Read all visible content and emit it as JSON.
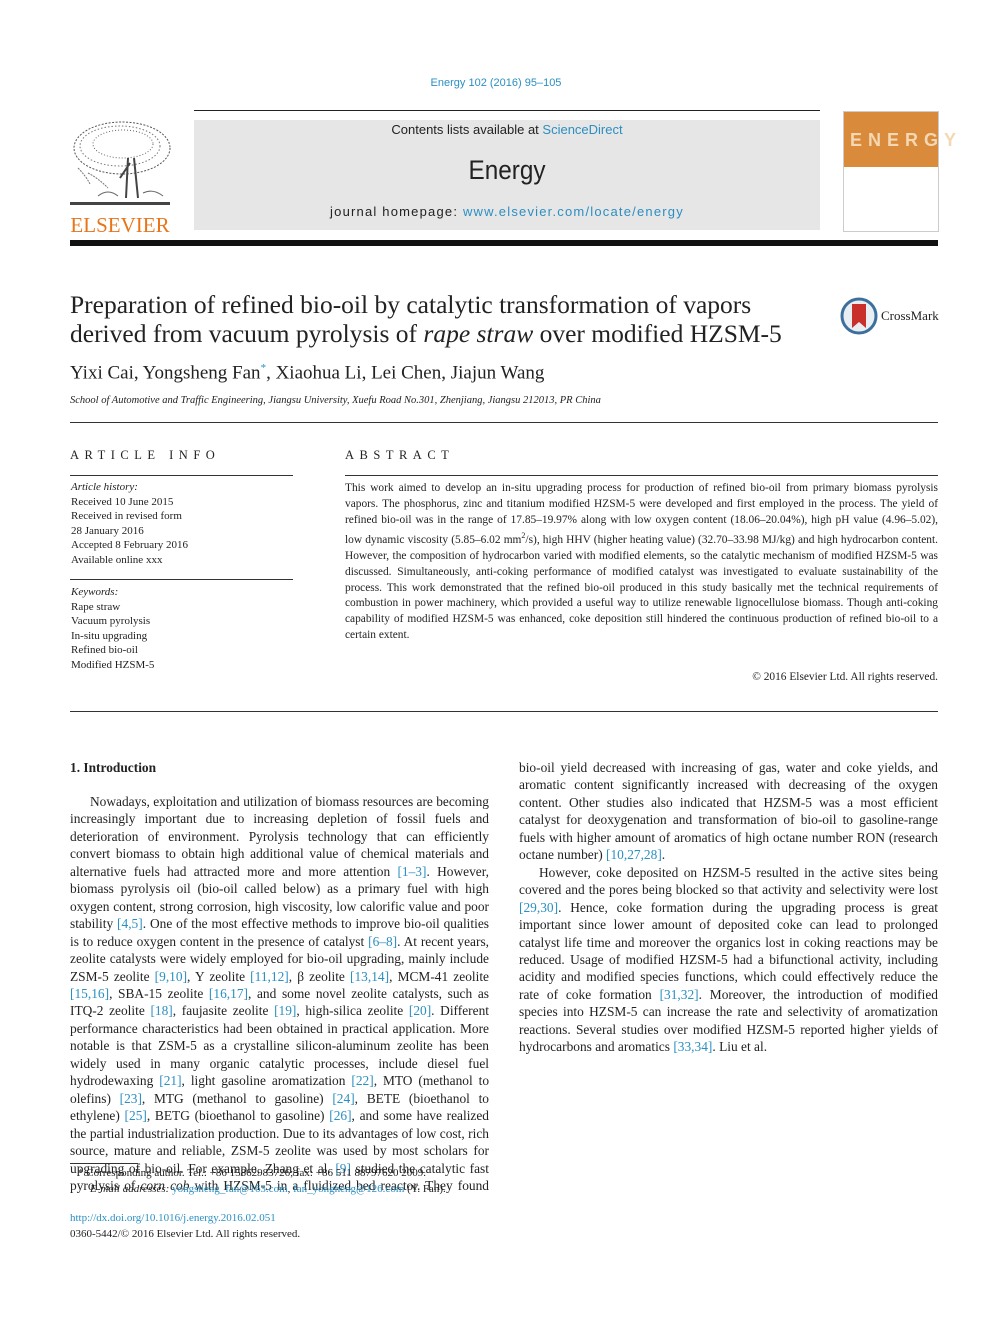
{
  "header": {
    "journal_ref": "Energy 102 (2016) 95–105",
    "contents_prefix": "Contents lists available at ",
    "contents_link": "ScienceDirect",
    "journal_name": "Energy",
    "homepage_prefix": "journal homepage: ",
    "homepage_link": "www.elsevier.com/locate/energy",
    "publisher_logo_text": "ELSEVIER",
    "cover_word": "ENERGY",
    "brand_color": "#e8751a",
    "link_color": "#2b8fc2",
    "cover_color": "#d98a3a"
  },
  "article": {
    "title_part1": "Preparation of refined bio-oil by catalytic transformation of vapors derived from vacuum pyrolysis of ",
    "title_italic": "rape straw",
    "title_part2": " over modified HZSM-5",
    "crossmark_label": "CrossMark",
    "authors_part1": "Yixi Cai, Yongsheng Fan",
    "authors_mark": "*",
    "authors_part2": ", Xiaohua Li, Lei Chen, Jiajun Wang",
    "affiliation": "School of Automotive and Traffic Engineering, Jiangsu University, Xuefu Road No.301, Zhenjiang, Jiangsu 212013, PR China"
  },
  "article_info": {
    "label": "ARTICLE INFO",
    "history_label": "Article history:",
    "history": [
      "Received 10 June 2015",
      "Received in revised form",
      "28 January 2016",
      "Accepted 8 February 2016",
      "Available online xxx"
    ],
    "keywords_label": "Keywords:",
    "keywords": [
      "Rape straw",
      "Vacuum pyrolysis",
      "In-situ upgrading",
      "Refined bio-oil",
      "Modified HZSM-5"
    ]
  },
  "abstract": {
    "label": "ABSTRACT",
    "text_part1": "This work aimed to develop an in-situ upgrading process for production of refined bio-oil from primary biomass pyrolysis vapors. The phosphorus, zinc and titanium modified HZSM-5 were developed and first employed in the process. The yield of refined bio-oil was in the range of 17.85–19.97% along with low oxygen content (18.06–20.04%), high pH value (4.96–5.02), low dynamic viscosity (5.85–6.02 mm",
    "text_sup": "2",
    "text_part2": "/s), high HHV (higher heating value) (32.70–33.98 MJ/kg) and high hydrocarbon content. However, the composition of hydrocarbon varied with modified elements, so the catalytic mechanism of modified HZSM-5 was discussed. Simultaneously, anti-coking performance of modified catalyst was investigated to evaluate sustainability of the process. This work demonstrated that the refined bio-oil produced in this study basically met the technical requirements of combustion in power machinery, which provided a useful way to utilize renewable lignocellulose biomass. Though anti-coking capability of modified HZSM-5 was enhanced, coke deposition still hindered the continuous production of refined bio-oil to a certain extent.",
    "copyright": "© 2016 Elsevier Ltd. All rights reserved."
  },
  "body": {
    "intro_heading": "1.  Introduction",
    "p1": [
      {
        "t": "Nowadays, exploitation and utilization of biomass resources are becoming increasingly important due to increasing depletion of fossil fuels and deterioration of environment. Pyrolysis technology that can efficiently convert biomass to obtain high additional value of chemical materials and alternative fuels had attracted more and more attention "
      },
      {
        "r": "[1–3]"
      },
      {
        "t": ". However, biomass pyrolysis oil (bio-oil called below) as a primary fuel with high oxygen content, strong corrosion, high viscosity, low calorific value and poor stability "
      },
      {
        "r": "[4,5]"
      },
      {
        "t": ". One of the most effective methods to improve bio-oil qualities is to reduce oxygen content in the presence of catalyst "
      },
      {
        "r": "[6–8]"
      },
      {
        "t": ". At recent years, zeolite catalysts were widely employed for bio-oil upgrading, mainly include ZSM-5 zeolite "
      },
      {
        "r": "[9,10]"
      },
      {
        "t": ", Y zeolite "
      },
      {
        "r": "[11,12]"
      },
      {
        "t": ", β zeolite "
      },
      {
        "r": "[13,14]"
      },
      {
        "t": ", MCM-41 zeolite "
      },
      {
        "r": "[15,16]"
      },
      {
        "t": ", SBA-15 zeolite "
      },
      {
        "r": "[16,17]"
      },
      {
        "t": ", and some novel zeolite catalysts, such as ITQ-2 zeolite "
      },
      {
        "r": "[18]"
      },
      {
        "t": ", faujasite zeolite "
      },
      {
        "r": "[19]"
      },
      {
        "t": ", high-silica zeolite "
      },
      {
        "r": "[20]"
      },
      {
        "t": ". Different performance characteristics had been obtained in practical application. More notable is that ZSM-5 as a crystalline silicon-aluminum zeolite has been widely used in many organic catalytic processes, include diesel fuel hydrodewaxing "
      },
      {
        "r": "[21]"
      },
      {
        "t": ", light gasoline aromatization "
      },
      {
        "r": "[22]"
      },
      {
        "t": ", MTO (methanol to olefins) "
      },
      {
        "r": "[23]"
      },
      {
        "t": ", MTG (methanol to gasoline) "
      },
      {
        "r": "[24]"
      },
      {
        "t": ", BETE (bioethanol to ethylene) "
      },
      {
        "r": "[25]"
      },
      {
        "t": ", BETG (bioethanol to gasoline) "
      },
      {
        "r": "[26]"
      },
      {
        "t": ", and some have realized the partial industrialization production. Due to its advantages of low cost, rich source, mature and reliable, ZSM-5 zeolite was used by most scholars for upgrading of bio-oil. For example, Zhang et al. "
      },
      {
        "r": "[9]"
      },
      {
        "t": " studied the catalytic fast pyrolysis of "
      },
      {
        "i": "corn cob"
      },
      {
        "t": " with HZSM-5 in a fluidized bed reactor. They found bio-oil yield decreased with increasing of gas, water and coke yields, and aromatic content significantly increased with decreasing of the oxygen content. Other studies also indicated that HZSM-5 was a most efficient catalyst for deoxygenation and transformation of bio-oil to gasoline-range fuels with higher amount of aromatics of high octane number RON (research octane number) "
      },
      {
        "r": "[10,27,28]"
      },
      {
        "t": "."
      }
    ],
    "p2": [
      {
        "t": "However, coke deposited on HZSM-5 resulted in the active sites being covered and the pores being blocked so that activity and selectivity were lost "
      },
      {
        "r": "[29,30]"
      },
      {
        "t": ". Hence, coke formation during the upgrading process is great important since lower amount of deposited coke can lead to prolonged catalyst life time and moreover the organics lost in coking reactions may be reduced. Usage of modified HZSM-5 had a bifunctional activity, including acidity and modified species functions, which could effectively reduce the rate of coke formation "
      },
      {
        "r": "[31,32]"
      },
      {
        "t": ". Moreover, the introduction of modified species into HZSM-5 can increase the rate and selectivity of aromatization reactions. Several studies over modified HZSM-5 reported higher yields of hydrocarbons and aromatics "
      },
      {
        "r": "[33,34]"
      },
      {
        "t": ". Liu et al."
      }
    ]
  },
  "footnote": {
    "mark": "*",
    "corresponding": " Corresponding author. Tel.: +86 15862983726; fax: +86 511 88797620 2009.",
    "email_label": "E-mail addresses: ",
    "email1": "yongsheng_fan@163.com",
    "sep": ", ",
    "email2": "fan_yongheng@126.com",
    "email_suffix": " (Y. Fan).",
    "doi": "http://dx.doi.org/10.1016/j.energy.2016.02.051",
    "issn": "0360-5442/© 2016 Elsevier Ltd. All rights reserved."
  }
}
